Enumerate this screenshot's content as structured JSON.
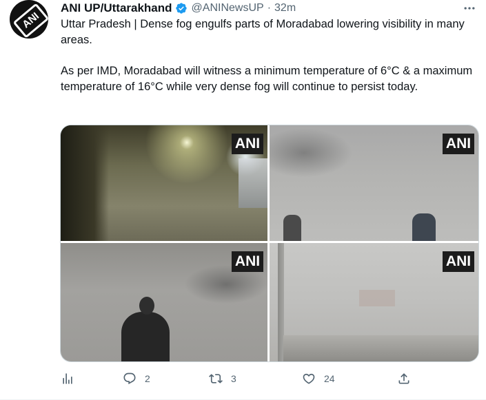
{
  "tweet": {
    "author_name": "ANI UP/Uttarakhand",
    "handle": "@ANINewsUP",
    "separator": "·",
    "time": "32m",
    "paragraph1": "Uttar Pradesh | Dense fog engulfs parts of Moradabad lowering visibility in many areas.",
    "paragraph2": "As per IMD, Moradabad will witness a minimum temperature of 6°C & a maximum temperature of 16°C while very dense fog will continue to persist today.",
    "avatar_logo": "ANI",
    "verified_color": "#1d9bf0"
  },
  "media": {
    "watermark": "ANI",
    "images": [
      {
        "watermark": "ANI"
      },
      {
        "watermark": "ANI"
      },
      {
        "watermark": "ANI"
      },
      {
        "watermark": "ANI"
      }
    ]
  },
  "actions": {
    "views_icon": "analytics-icon",
    "reply_count": "2",
    "retweet_count": "3",
    "like_count": "24",
    "share_icon": "share-icon"
  }
}
